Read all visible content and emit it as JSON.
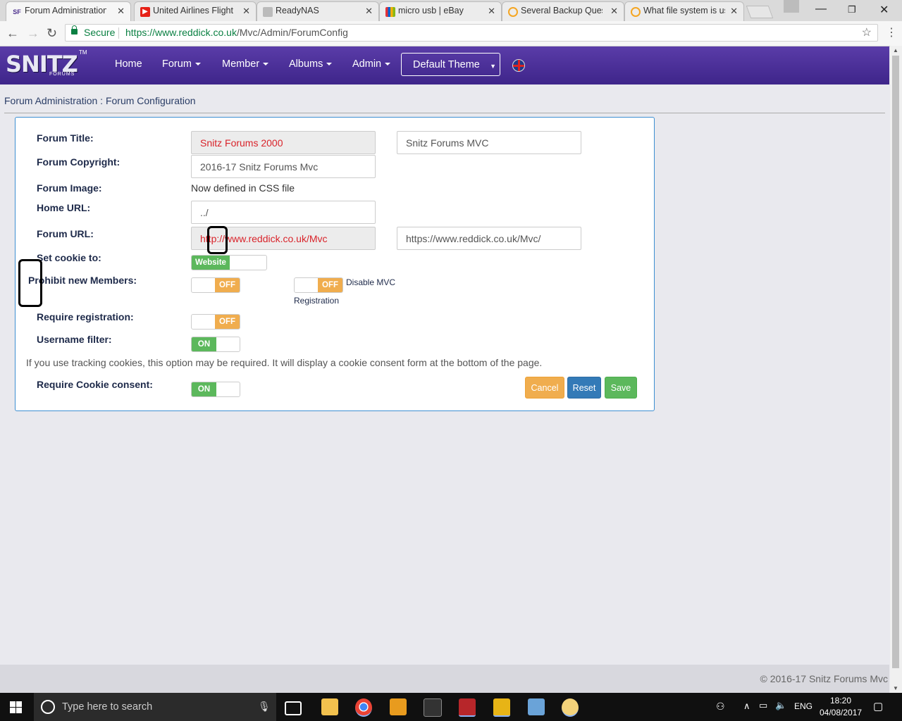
{
  "browser": {
    "tabs": [
      {
        "title": "Forum Administration",
        "favicon": "SF",
        "active": true
      },
      {
        "title": "United Airlines Flight",
        "favicon": "youtube-icon",
        "active": false
      },
      {
        "title": "ReadyNAS",
        "favicon": "page-icon",
        "active": false
      },
      {
        "title": "micro usb | eBay",
        "favicon": "ebay-icon",
        "active": false
      },
      {
        "title": "Several Backup Quest",
        "favicon": "forum-icon",
        "active": false
      },
      {
        "title": "What file system is us",
        "favicon": "forum-icon",
        "active": false
      }
    ],
    "secure_label": "Secure",
    "url_host": "https://www.reddick.co.uk",
    "url_path": "/Mvc/Admin/ForumConfig"
  },
  "site": {
    "logo_text": "SNITZ",
    "logo_sub": "FORUMS",
    "logo_tm": "TM",
    "nav": [
      "Home",
      "Forum",
      "Member",
      "Albums",
      "Admin"
    ],
    "theme_label": "Default Theme",
    "breadcrumb": "Forum Administration : Forum Configuration"
  },
  "form": {
    "forum_title_label": "Forum Title:",
    "forum_title_current": "Snitz Forums 2000",
    "forum_title_new": "Snitz Forums MVC",
    "copyright_label": "Forum Copyright:",
    "copyright_value": "2016-17 Snitz Forums Mvc",
    "image_label": "Forum Image:",
    "image_value": "Now defined in CSS file",
    "home_url_label": "Home URL:",
    "home_url_value": "../",
    "forum_url_label": "Forum URL:",
    "forum_url_current": "http://www.reddick.co.uk/Mvc",
    "forum_url_new": "https://www.reddick.co.uk/Mvc/",
    "cookie_label": "Set cookie to:",
    "cookie_value": "Website",
    "prohibit_label": "Prohibit new Members:",
    "prohibit_state": "OFF",
    "disable_mvc_state": "OFF",
    "disable_mvc_label": "Disable MVC",
    "disable_mvc_label2": "Registration",
    "require_reg_label": "Require registration:",
    "require_reg_state": "OFF",
    "username_filter_label": "Username filter:",
    "username_filter_state": "ON",
    "help_text": "If you use tracking cookies, this option may be required. It will display a cookie consent form at the bottom of the page.",
    "cookie_consent_label": "Require Cookie consent:",
    "cookie_consent_state": "ON",
    "cancel": "Cancel",
    "reset": "Reset",
    "save": "Save"
  },
  "footer": "© 2016-17 Snitz Forums Mvc",
  "taskbar": {
    "search_placeholder": "Type here to search",
    "lang": "ENG",
    "time": "18:20",
    "date": "04/08/2017"
  }
}
